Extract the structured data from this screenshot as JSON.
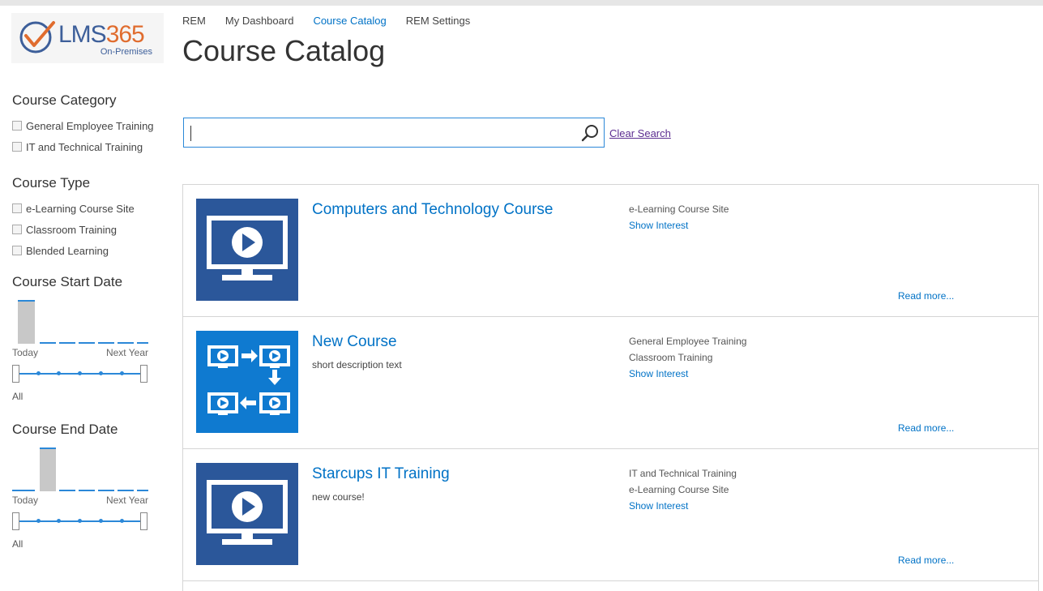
{
  "logo": {
    "brand_prefix": "LMS",
    "brand_suffix": "365",
    "subtitle": "On-Premises"
  },
  "nav": [
    {
      "label": "REM",
      "active": false
    },
    {
      "label": "My Dashboard",
      "active": false
    },
    {
      "label": "Course Catalog",
      "active": true
    },
    {
      "label": "REM Settings",
      "active": false
    }
  ],
  "page_title": "Course Catalog",
  "sidebar": {
    "course_category": {
      "title": "Course Category",
      "items": [
        "General Employee Training",
        "IT and Technical Training"
      ]
    },
    "course_type": {
      "title": "Course Type",
      "items": [
        "e-Learning Course Site",
        "Classroom Training",
        "Blended Learning"
      ]
    },
    "course_start_date": {
      "title": "Course Start Date",
      "left_label": "Today",
      "right_label": "Next Year",
      "all_label": "All"
    },
    "course_end_date": {
      "title": "Course End Date",
      "left_label": "Today",
      "right_label": "Next Year",
      "all_label": "All"
    }
  },
  "search": {
    "value": "",
    "placeholder": "",
    "clear_label": "Clear Search"
  },
  "courses": [
    {
      "title": "Computers and Technology Course",
      "description": "",
      "meta": [
        "e-Learning Course Site"
      ],
      "show_interest": "Show Interest",
      "read_more": "Read more...",
      "thumb_icon": "monitor-play-icon"
    },
    {
      "title": "New Course",
      "description": "short description text",
      "meta": [
        "General Employee Training",
        "Classroom Training"
      ],
      "show_interest": "Show Interest",
      "read_more": "Read more...",
      "thumb_icon": "blended-flow-icon"
    },
    {
      "title": "Starcups IT Training",
      "description": "new course!",
      "meta": [
        "IT and Technical Training",
        "e-Learning Course Site"
      ],
      "show_interest": "Show Interest",
      "read_more": "Read more...",
      "thumb_icon": "monitor-play-icon"
    }
  ],
  "colors": {
    "accent": "#0072c6",
    "brand_blue": "#2b579a",
    "brand_orange": "#e06c2e",
    "link_purple": "#5c2d91"
  }
}
